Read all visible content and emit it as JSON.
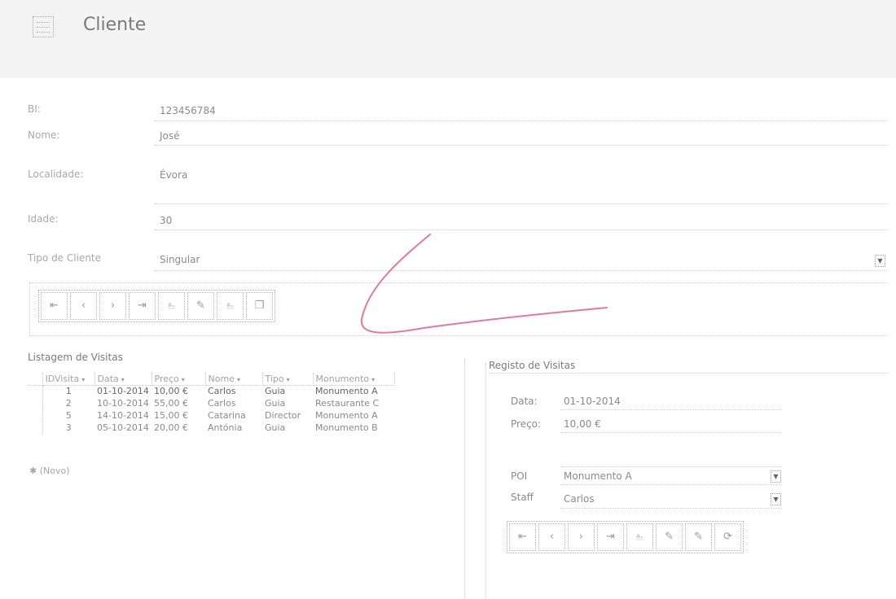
{
  "header": {
    "title": "Cliente",
    "icon": "form-icon"
  },
  "fields": [
    {
      "label": "BI:",
      "value": "123456784"
    },
    {
      "label": "Nome:",
      "value": "José"
    },
    {
      "label": "Localidade:",
      "value": "Évora"
    },
    {
      "label": "Idade:",
      "value": "30"
    },
    {
      "label": "Tipo de Cliente",
      "value": "Singular"
    }
  ],
  "main_toolbar": {
    "buttons": [
      "⇤",
      "‹",
      "›",
      "⇥",
      "⎁",
      "✎",
      "⎁",
      "❐"
    ]
  },
  "visit_list": {
    "title": "Listagem de Visitas",
    "columns": [
      "IDVisita",
      "Data",
      "Preço",
      "Nome",
      "Tipo",
      "Monumento"
    ],
    "rows": [
      [
        "1",
        "01-10-2014",
        "10,00 €",
        "Carlos",
        "Guia",
        "Monumento A"
      ],
      [
        "2",
        "10-10-2014",
        "55,00 €",
        "Carlos",
        "Guia",
        "Restaurante C"
      ],
      [
        "5",
        "14-10-2014",
        "15,00 €",
        "Catarina",
        "Director",
        "Monumento A"
      ],
      [
        "3",
        "05-10-2014",
        "20,00 €",
        "Antónia",
        "Guia",
        "Monumento B"
      ]
    ],
    "new_row": "(Novo)"
  },
  "visit_record": {
    "title": "Registo de Visitas",
    "date_label": "Data:",
    "date_value": "01-10-2014",
    "price_label": "Preço:",
    "price_value": "10,00 €",
    "poi_label": "POI",
    "poi_value": "Monumento A",
    "staff_label": "Staff",
    "staff_value": "Carlos",
    "toolbar_buttons": [
      "⇤",
      "‹",
      "›",
      "⇥",
      "⎁",
      "✎",
      "✎",
      "⟳"
    ]
  },
  "colors": {
    "header_bg": "#f4f4f4",
    "signature": "#e07aa0"
  }
}
